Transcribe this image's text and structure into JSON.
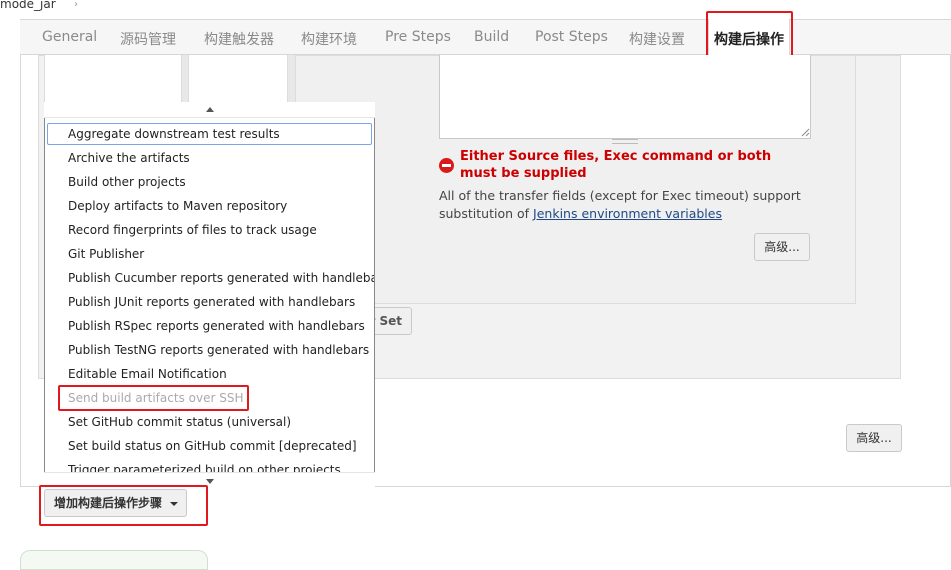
{
  "breadcrumb": {
    "job_name": "mode_jar",
    "separator": "›"
  },
  "tabs": [
    {
      "label": "General"
    },
    {
      "label": "源码管理"
    },
    {
      "label": "构建触发器"
    },
    {
      "label": "构建环境"
    },
    {
      "label": "Pre Steps"
    },
    {
      "label": "Build"
    },
    {
      "label": "Post Steps"
    },
    {
      "label": "构建设置"
    },
    {
      "label": "构建后操作"
    }
  ],
  "ssh": {
    "error": "Either Source files, Exec command or both must be supplied",
    "help_prefix": "All of the transfer fields (except for Exec timeout) support substitution of ",
    "help_link": "Jenkins environment variables",
    "advanced_label": "高级...",
    "add_set_partial": "r Set"
  },
  "section": {
    "advanced_label": "高级..."
  },
  "dropdown": {
    "items": [
      {
        "label": "Aggregate downstream test results",
        "state": "focused"
      },
      {
        "label": "Archive the artifacts"
      },
      {
        "label": "Build other projects"
      },
      {
        "label": "Deploy artifacts to Maven repository"
      },
      {
        "label": "Record fingerprints of files to track usage"
      },
      {
        "label": "Git Publisher"
      },
      {
        "label": "Publish Cucumber reports generated with handlebars"
      },
      {
        "label": "Publish JUnit reports generated with handlebars"
      },
      {
        "label": "Publish RSpec reports generated with handlebars"
      },
      {
        "label": "Publish TestNG reports generated with handlebars"
      },
      {
        "label": "Editable Email Notification"
      },
      {
        "label": "Send build artifacts over SSH",
        "state": "disabled"
      },
      {
        "label": "Set GitHub commit status (universal)"
      },
      {
        "label": "Set build status on GitHub commit [deprecated]"
      },
      {
        "label": "Trigger parameterized build on other projects"
      }
    ]
  },
  "add_step": {
    "label": "增加构建后操作步骤"
  },
  "colors": {
    "highlight": "#e0191f",
    "error": "#cc0000",
    "link": "#204a87"
  }
}
